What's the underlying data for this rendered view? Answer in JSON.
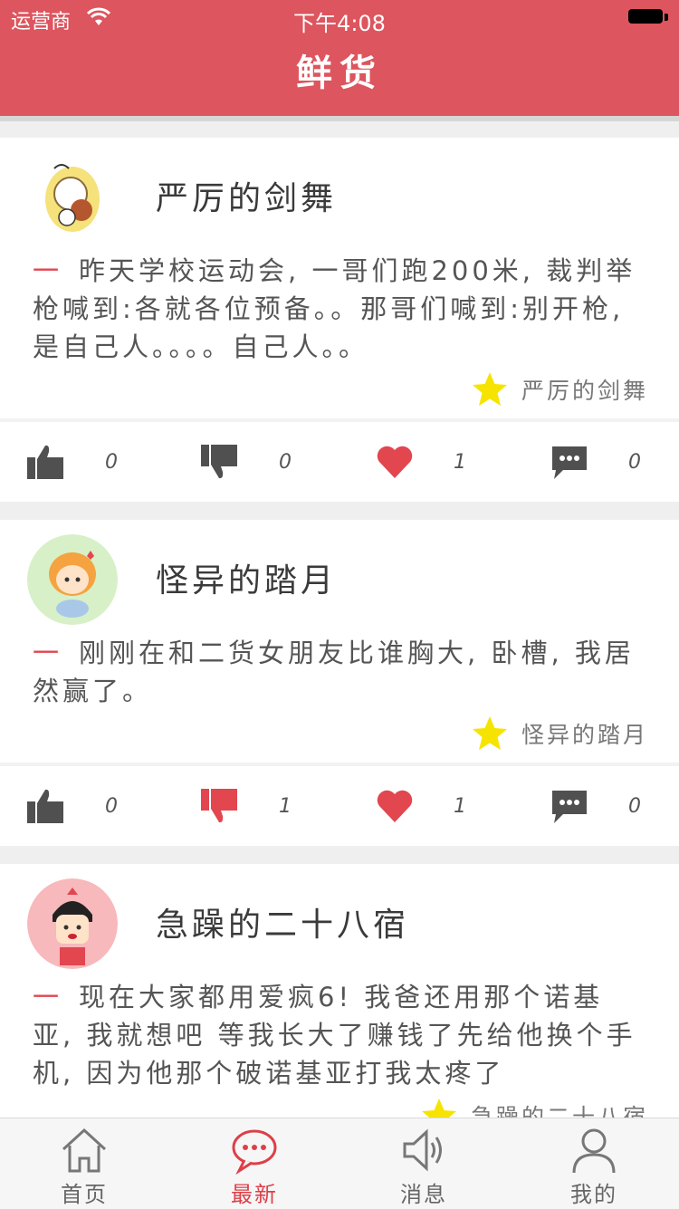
{
  "status_bar": {
    "carrier": "运营商",
    "time": "下午4:08"
  },
  "nav": {
    "title": "鲜货"
  },
  "colors": {
    "brand": "#dd555e",
    "accent": "#e2464f",
    "star": "#f6e400"
  },
  "posts": [
    {
      "author": "严厉的剑舞",
      "dash": "一",
      "content": "昨天学校运动会, 一哥们跑200米, 裁判举枪喊到:各就各位预备。。那哥们喊到:别开枪, 是自己人。。。。自己人。。",
      "signature": "严厉的剑舞",
      "likes": "0",
      "dislikes": "0",
      "hearts": "1",
      "comments": "0",
      "dislike_active": false
    },
    {
      "author": "怪异的踏月",
      "dash": "一",
      "content": "刚刚在和二货女朋友比谁胸大, 卧槽, 我居然赢了。",
      "signature": "怪异的踏月",
      "likes": "0",
      "dislikes": "1",
      "hearts": "1",
      "comments": "0",
      "dislike_active": true
    },
    {
      "author": "急躁的二十八宿",
      "dash": "一",
      "content": "现在大家都用爱疯6! 我爸还用那个诺基亚, 我就想吧 等我长大了赚钱了先给他换个手机, 因为他那个破诺基亚打我太疼了",
      "signature": "急躁的二十八宿"
    }
  ],
  "tabs": [
    {
      "label": "首页",
      "icon": "home-icon"
    },
    {
      "label": "最新",
      "icon": "chat-bubble-icon",
      "active": true
    },
    {
      "label": "消息",
      "icon": "speaker-icon"
    },
    {
      "label": "我的",
      "icon": "person-icon"
    }
  ]
}
